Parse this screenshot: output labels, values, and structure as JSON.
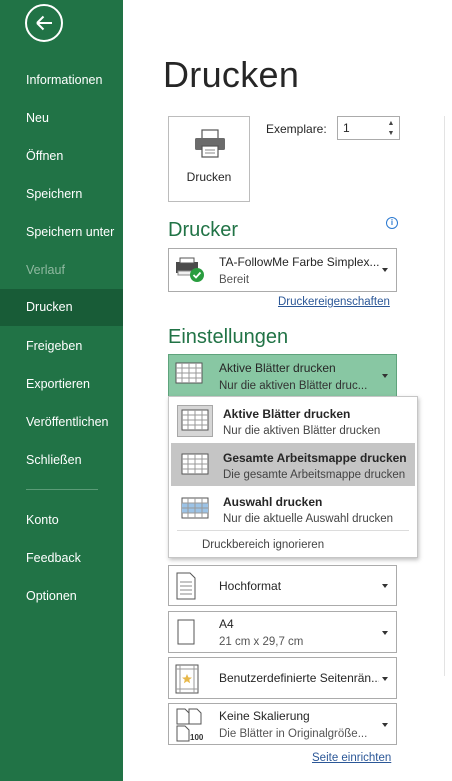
{
  "sidebar": {
    "back_icon": "arrow-left-icon",
    "items": [
      {
        "label": "Informationen",
        "state": "normal"
      },
      {
        "label": "Neu",
        "state": "normal"
      },
      {
        "label": "Öffnen",
        "state": "normal"
      },
      {
        "label": "Speichern",
        "state": "normal"
      },
      {
        "label": "Speichern unter",
        "state": "normal"
      },
      {
        "label": "Verlauf",
        "state": "disabled"
      },
      {
        "label": "Drucken",
        "state": "active"
      },
      {
        "label": "Freigeben",
        "state": "normal"
      },
      {
        "label": "Exportieren",
        "state": "normal"
      },
      {
        "label": "Veröffentlichen",
        "state": "normal"
      },
      {
        "label": "Schließen",
        "state": "normal"
      },
      {
        "label": "Konto",
        "state": "normal"
      },
      {
        "label": "Feedback",
        "state": "normal"
      },
      {
        "label": "Optionen",
        "state": "normal"
      }
    ]
  },
  "main": {
    "title": "Drucken",
    "print_button_label": "Drucken",
    "copies_label": "Exemplare:",
    "copies_value": "1",
    "printer_heading": "Drucker",
    "printer": {
      "name": "TA-FollowMe Farbe Simplex...",
      "status": "Bereit",
      "properties_link": "Druckereigenschaften"
    },
    "settings_heading": "Einstellungen",
    "selected_setting": {
      "title": "Aktive Blätter drucken",
      "subtitle": "Nur die aktiven Blätter druc..."
    },
    "orientation": "Hochformat",
    "paper": {
      "title": "A4",
      "subtitle": "21 cm x 29,7 cm"
    },
    "margins": "Benutzerdefinierte Seitenrän...",
    "scaling": {
      "title": "Keine Skalierung",
      "subtitle": "Die Blätter in Originalgröße..."
    },
    "page_setup_link": "Seite einrichten"
  },
  "popup": {
    "items": [
      {
        "title": "Aktive Blätter drucken",
        "subtitle": "Nur die aktiven Blätter drucken"
      },
      {
        "title": "Gesamte Arbeitsmappe drucken",
        "subtitle": "Die gesamte Arbeitsmappe drucken"
      },
      {
        "title": "Auswahl drucken",
        "subtitle": "Nur die aktuelle Auswahl drucken"
      }
    ],
    "footer": "Druckbereich ignorieren"
  },
  "colors": {
    "sidebar": "#217346",
    "sidebar_active": "#185c37",
    "accent_green": "#217346",
    "selected_dropdown": "#88c7a3",
    "link": "#2b5797"
  }
}
